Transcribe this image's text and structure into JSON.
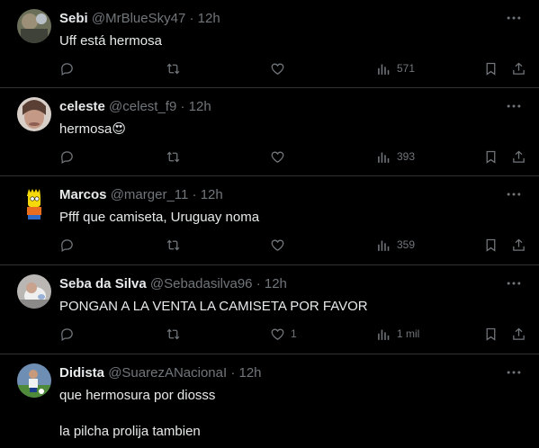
{
  "tweets": [
    {
      "name": "Sebi",
      "handle": "@MrBlueSky47",
      "time": "12h",
      "text": [
        "Uff está hermosa"
      ],
      "replies": "",
      "retweets": "",
      "likes": "",
      "views": "571",
      "avatar": "avatar-sebi"
    },
    {
      "name": "celeste",
      "handle": "@celest_f9",
      "time": "12h",
      "text": [
        "hermosa😍"
      ],
      "replies": "",
      "retweets": "",
      "likes": "",
      "views": "393",
      "avatar": "avatar-celeste"
    },
    {
      "name": "Marcos",
      "handle": "@marger_11",
      "time": "12h",
      "text": [
        "Pfff que camiseta, Uruguay noma"
      ],
      "replies": "",
      "retweets": "",
      "likes": "",
      "views": "359",
      "avatar": "avatar-marcos"
    },
    {
      "name": "Seba da Silva",
      "handle": "@Sebadasilva96",
      "time": "12h",
      "text": [
        "PONGAN A LA VENTA LA CAMISETA POR FAVOR"
      ],
      "replies": "",
      "retweets": "",
      "likes": "1",
      "views": "1 mil",
      "avatar": "avatar-seba"
    },
    {
      "name": "Didista",
      "handle": "@SuarezANacionaI",
      "time": "12h",
      "text": [
        "que hermosura por diosss",
        "la pilcha prolija tambien"
      ],
      "replies": "",
      "retweets": "",
      "likes": "",
      "views": "",
      "avatar": "avatar-didista"
    }
  ],
  "separator": " · ",
  "colors": {
    "background": "#000000",
    "text": "#e7e9ea",
    "muted": "#71767b",
    "border": "#2f3336"
  }
}
